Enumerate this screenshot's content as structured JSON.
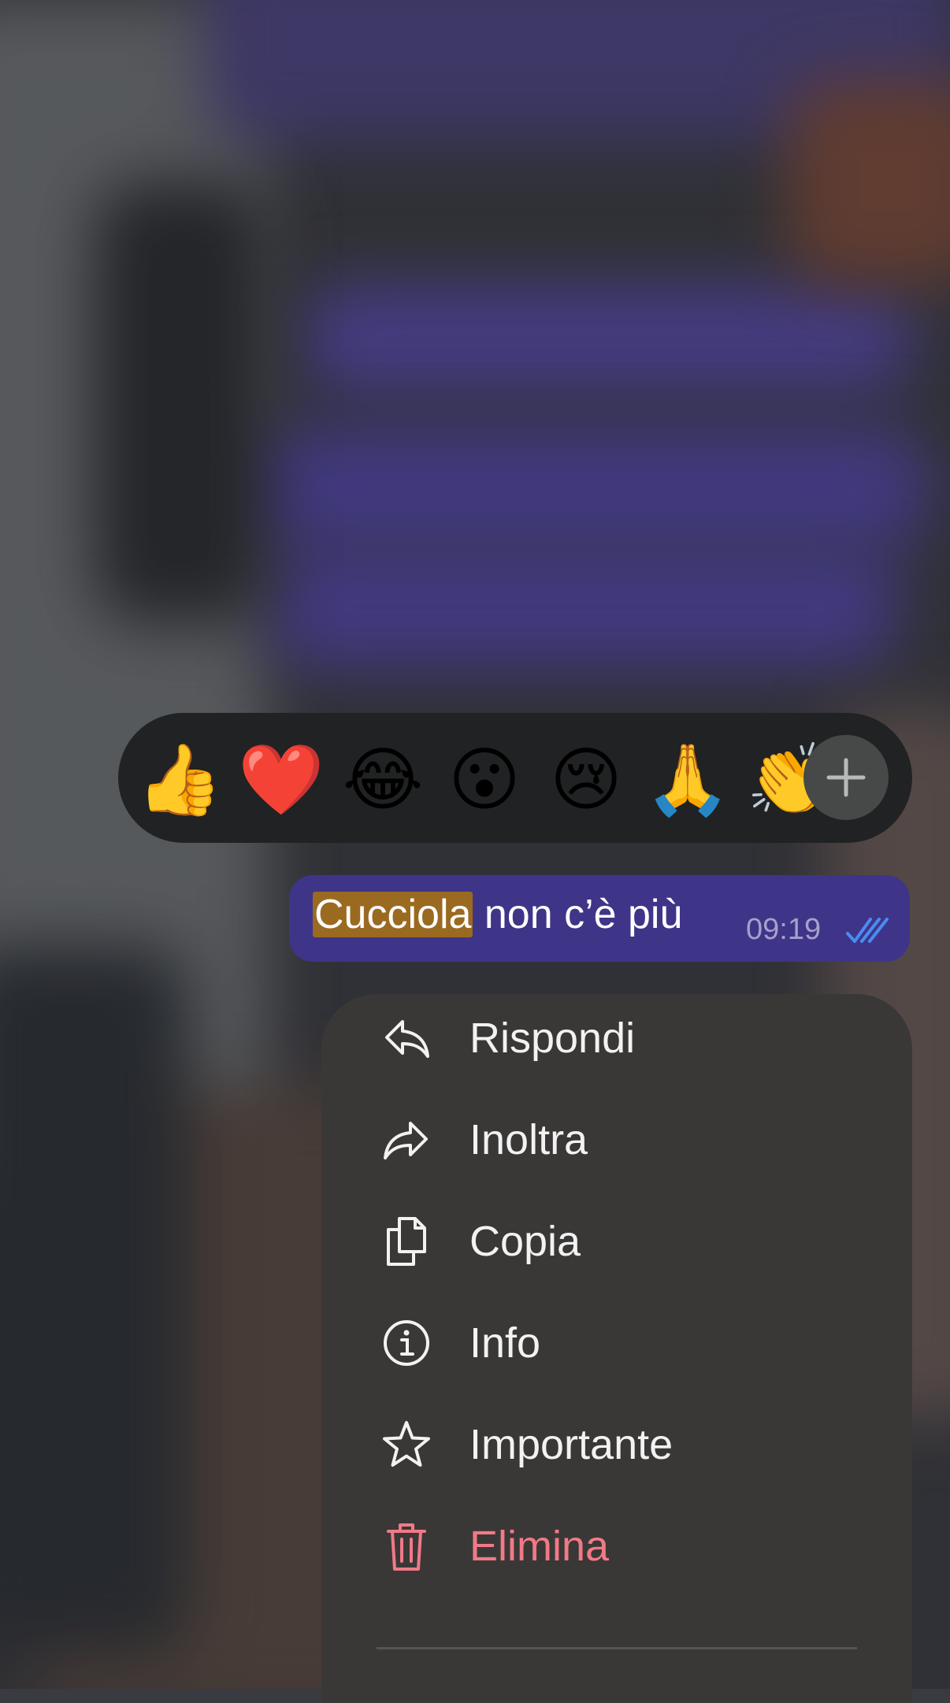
{
  "reactions": {
    "emojis": [
      "👍",
      "❤️",
      "😂",
      "😮",
      "😢",
      "🙏",
      "👏"
    ],
    "add_icon": "plus-icon"
  },
  "message": {
    "highlighted_text": "Cucciola",
    "text_rest": " non c’è più",
    "time": "09:19",
    "status_icon": "double-check-icon",
    "status_color": "#4a8cf0"
  },
  "menu": {
    "items": [
      {
        "label": "Rispondi",
        "icon": "reply-icon"
      },
      {
        "label": "Inoltra",
        "icon": "forward-icon"
      },
      {
        "label": "Copia",
        "icon": "copy-icon"
      },
      {
        "label": "Info",
        "icon": "info-icon"
      },
      {
        "label": "Importante",
        "icon": "star-icon"
      },
      {
        "label": "Elimina",
        "icon": "trash-icon",
        "color": "#f07a86"
      }
    ]
  },
  "colors": {
    "bubble": "#3e3589",
    "highlight": "#9b6a21",
    "menu_background": "#3a3837",
    "reaction_bar": "#212223"
  }
}
